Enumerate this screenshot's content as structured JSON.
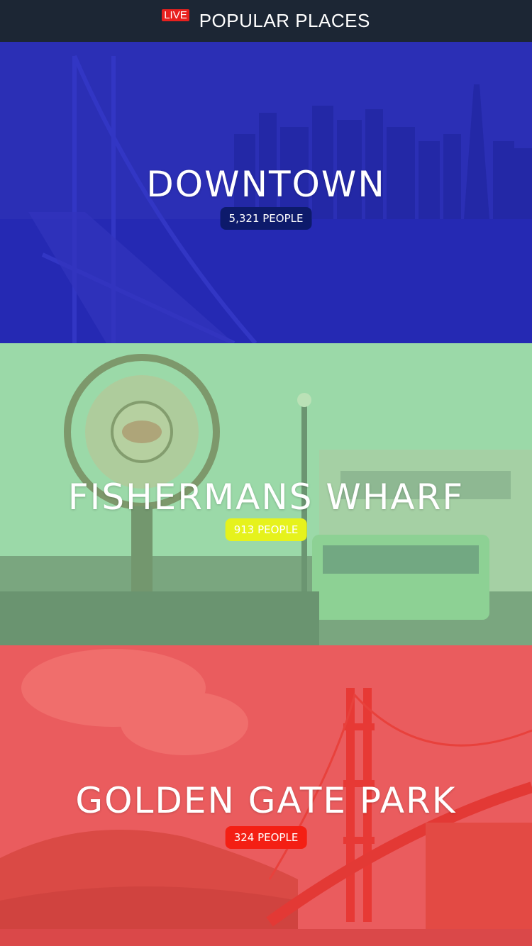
{
  "header": {
    "live_label": "LIVE",
    "title": "POPULAR PLACES"
  },
  "places": [
    {
      "name": "DOWNTOWN",
      "count_label": "5,321 PEOPLE",
      "overlay_color": "#2b2fd6",
      "badge_color": "#0d1a6b"
    },
    {
      "name": "FISHERMANS WHARF",
      "count_label": "913 PEOPLE",
      "overlay_color": "#8fdca0",
      "badge_color": "#e6f21c"
    },
    {
      "name": "GOLDEN GATE PARK",
      "count_label": "324 PEOPLE",
      "overlay_color": "#ef4b4e",
      "badge_color": "#f41f14"
    }
  ],
  "colors": {
    "header_bg": "#1c2634",
    "live_red": "#e8201e"
  }
}
